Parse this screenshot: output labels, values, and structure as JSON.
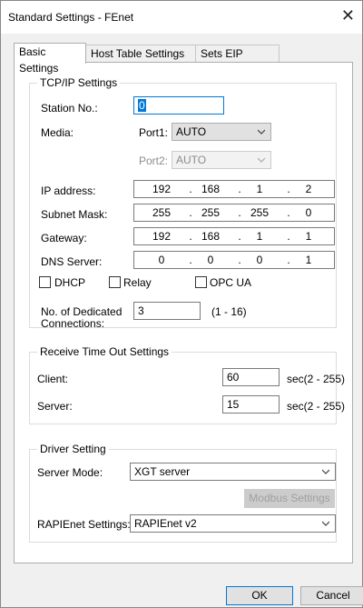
{
  "window": {
    "title": "Standard Settings - FEnet",
    "close_glyph": "✕"
  },
  "tabs": [
    {
      "label": "Basic Settings",
      "active": true
    },
    {
      "label": "Host Table Settings",
      "active": false
    },
    {
      "label": "Sets EIP Server",
      "active": false
    }
  ],
  "tcpip": {
    "title": "TCP/IP Settings",
    "station_label": "Station No.:",
    "station_value": "0",
    "media_label": "Media:",
    "port1_label": "Port1:",
    "port1_value": "AUTO",
    "port2_label": "Port2:",
    "port2_value": "AUTO",
    "ip_label": "IP address:",
    "ip": [
      "192",
      "168",
      "1",
      "2"
    ],
    "subnet_label": "Subnet Mask:",
    "subnet": [
      "255",
      "255",
      "255",
      "0"
    ],
    "gateway_label": "Gateway:",
    "gateway": [
      "192",
      "168",
      "1",
      "1"
    ],
    "dns_label": "DNS Server:",
    "dns": [
      "0",
      "0",
      "0",
      "1"
    ],
    "dhcp_label": "DHCP",
    "relay_label": "Relay",
    "opcua_label": "OPC UA",
    "dedicated_label_1": "No. of Dedicated",
    "dedicated_label_2": "Connections:",
    "dedicated_value": "3",
    "dedicated_range": "(1 - 16)"
  },
  "timeout": {
    "title": "Receive Time Out Settings",
    "client_label": "Client:",
    "client_value": "60",
    "client_unit": "sec(2 - 255)",
    "server_label": "Server:",
    "server_value": "15",
    "server_unit": "sec(2 - 255)"
  },
  "driver": {
    "title": "Driver Setting",
    "server_mode_label": "Server Mode:",
    "server_mode_value": "XGT server",
    "modbus_button": "Modbus Settings",
    "rapienet_label": "RAPIEnet Settings:",
    "rapienet_value": "RAPIEnet v2"
  },
  "footer": {
    "ok_label": "OK",
    "cancel_label": "Cancel"
  }
}
